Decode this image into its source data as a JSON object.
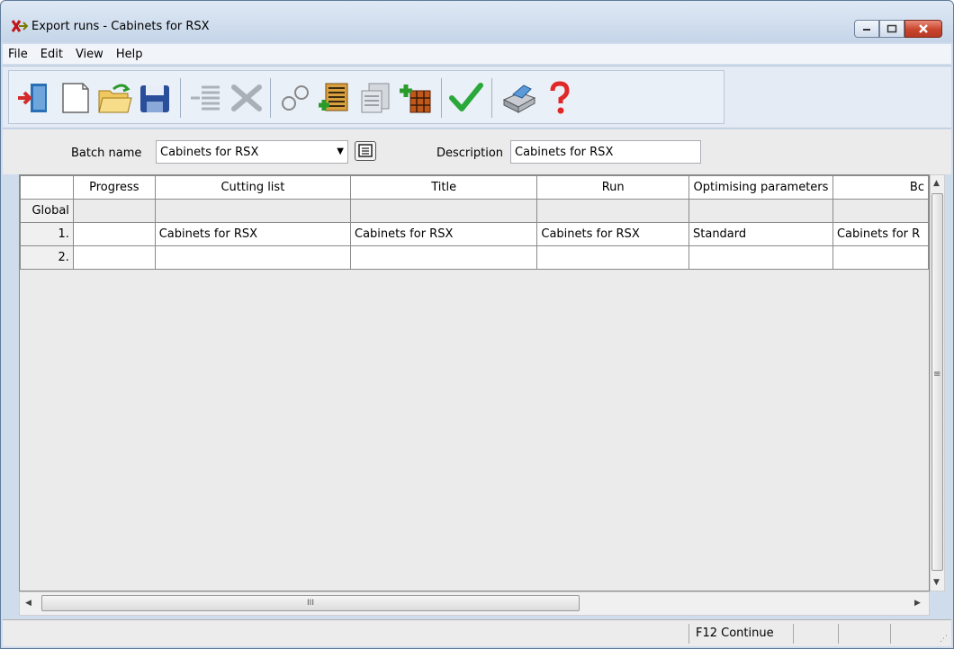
{
  "window": {
    "title": "Export runs - Cabinets for RSX",
    "app_icon": "cross-arrow-icon",
    "buttons": {
      "minimize": "minimize-icon",
      "maximize": "maximize-icon",
      "close": "close-icon"
    }
  },
  "menu": {
    "items": [
      {
        "label": "File"
      },
      {
        "label": "Edit"
      },
      {
        "label": "View"
      },
      {
        "label": "Help"
      }
    ]
  },
  "toolbar": {
    "icons": [
      "exit-icon",
      "new-icon",
      "open-icon",
      "save-icon",
      "list-icon",
      "delete-icon",
      "link-icon",
      "add-cutting-list-icon",
      "copy-list-icon",
      "add-board-icon",
      "ok-icon",
      "print-icon",
      "help-icon"
    ]
  },
  "form": {
    "batch_label": "Batch name",
    "batch_value": "Cabinets for RSX",
    "description_label": "Description",
    "description_value": "Cabinets for RSX"
  },
  "table": {
    "columns": [
      "Progress",
      "Cutting list",
      "Title",
      "Run",
      "Optimising parameters",
      "Bc"
    ],
    "rows": [
      {
        "label": "Global",
        "cells": [
          "",
          "",
          "",
          "",
          "",
          ""
        ]
      },
      {
        "label": "1.",
        "cells": [
          "",
          "Cabinets for RSX",
          "Cabinets for RSX",
          "Cabinets for RSX",
          "Standard",
          "Cabinets for R"
        ]
      },
      {
        "label": "2.",
        "cells": [
          "",
          "",
          "",
          "",
          "",
          ""
        ]
      }
    ]
  },
  "scroll": {
    "h_grip": "III",
    "v_grip": "≡"
  },
  "status": {
    "text": "F12 Continue"
  }
}
